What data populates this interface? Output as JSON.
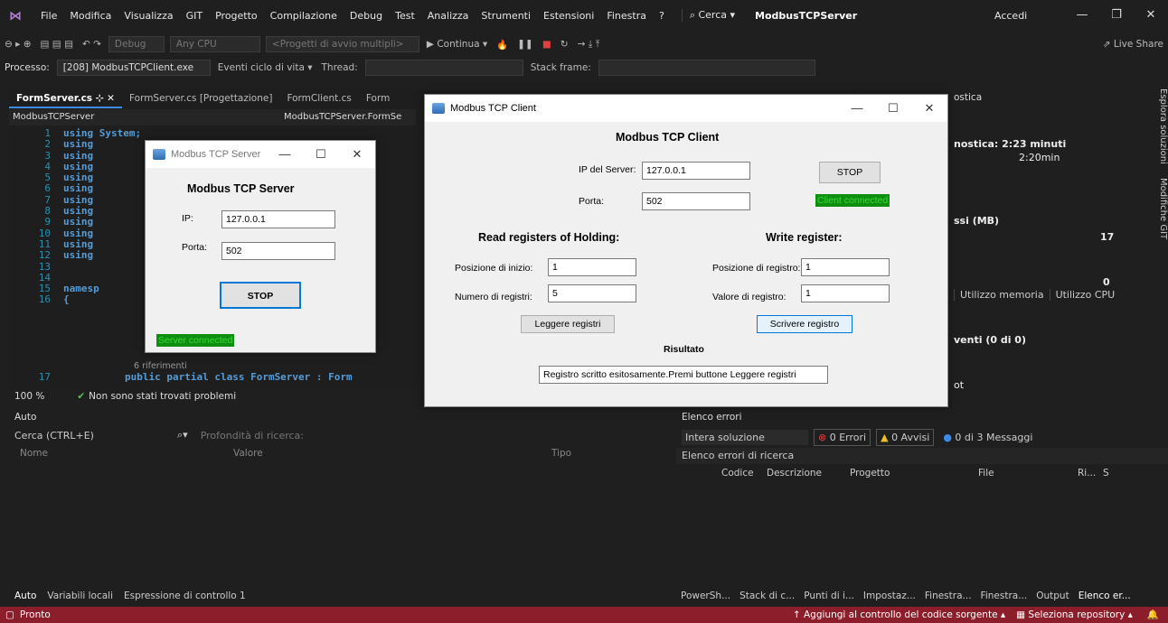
{
  "menubar": {
    "items": [
      "File",
      "Modifica",
      "Visualizza",
      "GIT",
      "Progetto",
      "Compilazione",
      "Debug",
      "Test",
      "Analizza",
      "Strumenti",
      "Estensioni",
      "Finestra",
      "?"
    ],
    "search": "Cerca",
    "title": "ModbusTCPServer",
    "signin": "Accedi"
  },
  "toolbar": {
    "config": "Debug",
    "platform": "Any CPU",
    "startup": "<Progetti di avvio multipli>",
    "continue": "Continua",
    "liveshare": "Live Share"
  },
  "debugbar": {
    "process_label": "Processo:",
    "process": "[208] ModbusTCPClient.exe",
    "lifecycle": "Eventi ciclo di vita",
    "thread": "Thread:",
    "stackframe": "Stack frame:"
  },
  "tabs": [
    "FormServer.cs",
    "FormServer.cs [Progettazione]",
    "FormClient.cs",
    "Form"
  ],
  "navbar": {
    "project": "ModbusTCPServer",
    "class": "ModbusTCPServer.FormSe"
  },
  "code": {
    "lines": [
      {
        "n": "1",
        "t": "using System;"
      },
      {
        "n": "2",
        "t": "using"
      },
      {
        "n": "3",
        "t": "using"
      },
      {
        "n": "4",
        "t": "using"
      },
      {
        "n": "5",
        "t": "using"
      },
      {
        "n": "6",
        "t": "using"
      },
      {
        "n": "7",
        "t": "using"
      },
      {
        "n": "8",
        "t": "using"
      },
      {
        "n": "9",
        "t": "using"
      },
      {
        "n": "10",
        "t": "using"
      },
      {
        "n": "11",
        "t": "using"
      },
      {
        "n": "12",
        "t": "using"
      },
      {
        "n": "13",
        "t": ""
      },
      {
        "n": "14",
        "t": ""
      },
      {
        "n": "15",
        "t": "namesp"
      },
      {
        "n": "16",
        "t": "{"
      }
    ],
    "refs": "6 riferimenti",
    "line17_n": "17",
    "line17": "public partial class FormServer : Form"
  },
  "editor_status": {
    "zoom": "100 %",
    "problems": "Non sono stati trovati problemi"
  },
  "diag": {
    "title": "ostica",
    "session": "nostica: 2:23 minuti",
    "time": "2:20min",
    "mem": "ssi (MB)",
    "val17": "17",
    "val0": "0",
    "tabs": [
      "Utilizzo memoria",
      "Utilizzo CPU"
    ],
    "events": "venti (0 di 0)",
    "ot": "ot"
  },
  "side": {
    "solution": "Esplora soluzioni",
    "git": "Modifiche GIT"
  },
  "auto": {
    "title": "Auto",
    "search": "Cerca (CTRL+E)",
    "depth": "Profondità di ricerca:",
    "cols": [
      "Nome",
      "Valore",
      "Tipo"
    ],
    "tabs": [
      "Auto",
      "Variabili locali",
      "Espressione di controllo 1"
    ]
  },
  "errors": {
    "title": "Elenco errori",
    "scope": "Intera soluzione",
    "errors": "0 Errori",
    "warnings": "0 Avvisi",
    "messages": "0 di 3 Messaggi",
    "search": "Elenco errori di ricerca",
    "cols": [
      "Codice",
      "Descrizione",
      "Progetto",
      "File",
      "Ri...",
      "S"
    ],
    "tabs": [
      "PowerSh...",
      "Stack di c...",
      "Punti di i...",
      "Impostaz...",
      "Finestra...",
      "Finestra...",
      "Output",
      "Elenco er..."
    ]
  },
  "server": {
    "title": "Modbus TCP Server",
    "header": "Modbus TCP Server",
    "ip_label": "IP:",
    "ip": "127.0.0.1",
    "port_label": "Porta:",
    "port": "502",
    "stop": "STOP",
    "status": "Server connected"
  },
  "client": {
    "title": "Modbus TCP Client",
    "header": "Modbus TCP Client",
    "ip_label": "IP del Server:",
    "ip": "127.0.0.1",
    "port_label": "Porta:",
    "port": "502",
    "stop": "STOP",
    "status": "Client connected",
    "read_header": "Read registers of Holding:",
    "write_header": "Write register:",
    "start_label": "Posizione di inizio:",
    "start": "1",
    "count_label": "Numero di registri:",
    "count": "5",
    "reg_pos_label": "Posizione di registro:",
    "reg_pos": "1",
    "reg_val_label": "Valore di registro:",
    "reg_val": "1",
    "read_btn": "Leggere registri",
    "write_btn": "Scrivere registro",
    "result_label": "Risultato",
    "result": "Registro scritto esitosamente.Premi buttone Leggere registri"
  },
  "statusbar": {
    "ready": "Pronto",
    "add_source": "Aggiungi al controllo del codice sorgente",
    "repo": "Seleziona repository"
  }
}
